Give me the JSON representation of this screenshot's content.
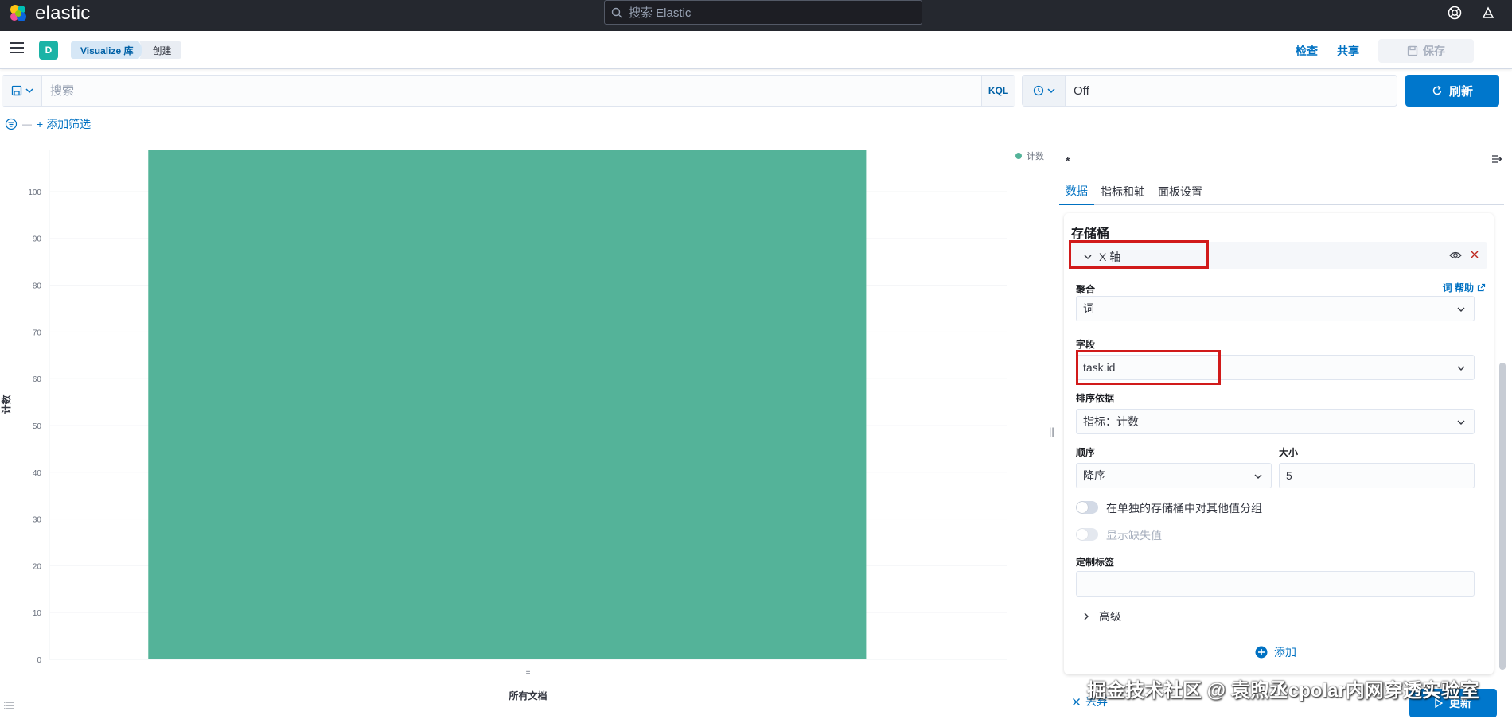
{
  "app": {
    "brand": "elastic",
    "search_placeholder": "搜索 Elastic"
  },
  "header": {
    "space_initial": "D",
    "breadcrumbs": [
      "Visualize 库",
      "创建"
    ],
    "inspect": "检查",
    "share": "共享",
    "save": "保存"
  },
  "query": {
    "placeholder": "搜索",
    "language": "KQL",
    "refresh_interval": "Off",
    "refresh_label": "刷新",
    "add_filter": "+ 添加筛选"
  },
  "chart_data": {
    "type": "bar",
    "categories": [
      "所有文档"
    ],
    "series": [
      {
        "name": "计数",
        "values": [
          109
        ]
      }
    ],
    "xlabel": "所有文档",
    "ylabel": "计数",
    "ylim": [
      0,
      109
    ],
    "yticks": [
      0,
      10,
      20,
      30,
      40,
      50,
      60,
      70,
      80,
      90,
      100
    ],
    "legend_position": "top-right",
    "color": "#54b399",
    "x_tick": "="
  },
  "panel": {
    "title": "*",
    "tabs": [
      "数据",
      "指标和轴",
      "面板设置"
    ],
    "active_tab": 0,
    "section_title": "存储桶",
    "agg_title": "X 轴",
    "aggregation_label": "聚合",
    "help_link": "词 帮助",
    "aggregation_value": "词",
    "field_label": "字段",
    "field_value": "task.id",
    "order_by_label": "排序依据",
    "order_by_value": "指标：计数",
    "order_label": "顺序",
    "order_value": "降序",
    "size_label": "大小",
    "size_value": "5",
    "group_other": "在单独的存储桶中对其他值分组",
    "show_missing": "显示缺失值",
    "custom_label": "定制标签",
    "custom_label_value": "",
    "advanced": "高级",
    "add": "添加",
    "discard": "丢弃",
    "update": "更新"
  },
  "watermark": "掘金技术社区 @ 袁煦丞cpolar内网穿透实验室"
}
